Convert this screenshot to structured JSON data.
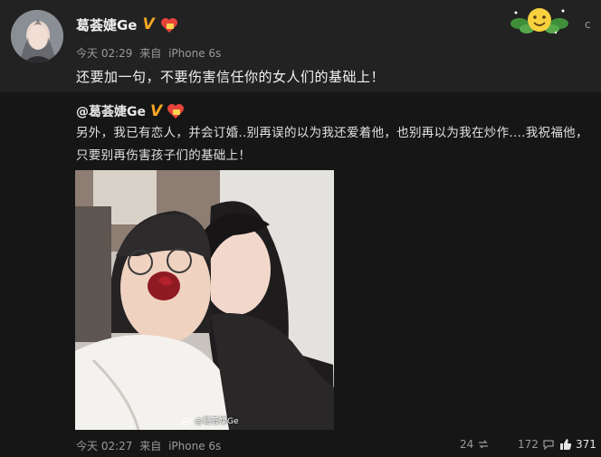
{
  "post": {
    "author": "葛荟婕Ge",
    "time": "今天 02:29",
    "source_prefix": "来自",
    "source": "iPhone 6s",
    "text": "还要加一句，不要伤害信任你的女人们的基础上！",
    "menu_chevron": "c"
  },
  "repost": {
    "author": "@葛荟婕Ge",
    "text_line1": "另外，我已有恋人，并会订婚..别再误的以为我还爱着他，也别再以为我在炒作....我祝福他，",
    "text_line2": "只要别再伤害孩子们的基础上！",
    "watermark": "@葛荟婕Ge",
    "time": "今天 02:27",
    "source_prefix": "来自",
    "source": "iPhone 6s",
    "reposts": "24",
    "comments": "172",
    "likes": "371"
  },
  "colors": {
    "page_bg": "#1b1b1b",
    "post_bg": "#222222",
    "repost_bg": "#161616",
    "verified_badge": "#f5a623",
    "meta_text": "#9a9a9a"
  },
  "icons": {
    "verified": "verified-v-icon",
    "vip": "vip-heart-icon",
    "repost": "repost-icon",
    "comment": "comment-icon",
    "like": "thumbs-up-icon",
    "decoration": "flower-smiley-decoration"
  }
}
